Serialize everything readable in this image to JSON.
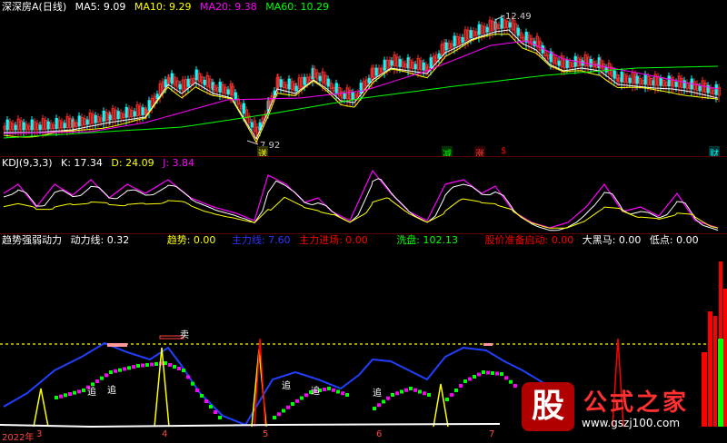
{
  "colors": {
    "bg": "#000000",
    "white": "#ffffff",
    "yellow": "#ffff00",
    "magenta": "#ff00ff",
    "green": "#00ff00",
    "cyan": "#00ffff",
    "blue": "#0000ff",
    "red": "#ff0000",
    "orange": "#ff8800"
  },
  "top": {
    "title": "深深房A(日线)",
    "ma": [
      {
        "label": "MA5: 9.09",
        "color": "#ffffff"
      },
      {
        "label": "MA10: 9.29",
        "color": "#ffff00"
      },
      {
        "label": "MA20: 9.38",
        "color": "#ff00ff"
      },
      {
        "label": "MA60: 10.29",
        "color": "#00ff00"
      }
    ],
    "high_label": "12.49",
    "low_label": "7.92",
    "events": [
      {
        "label": "送",
        "color": "#ffff00"
      },
      {
        "label": "减",
        "color": "#00ff00"
      },
      {
        "label": "涨",
        "color": "#ff0000"
      },
      {
        "label": "$",
        "color": "#ff0000"
      },
      {
        "label": "财",
        "color": "#00ffff"
      }
    ]
  },
  "kdj": {
    "title": "KDJ(9,3,3)",
    "k": "K: 17.34",
    "d": "D: 24.09",
    "j": "J: 3.84"
  },
  "bottom": {
    "title": "趋势强弱动力",
    "items": [
      {
        "label": "动力线: 0.32",
        "color": "#ffffff"
      },
      {
        "label": "趋势: 0.00",
        "color": "#ffff00"
      },
      {
        "label": "主力线: 7.60",
        "color": "#3333ff"
      },
      {
        "label": "主力进场: 0.00",
        "color": "#ff0000"
      },
      {
        "label": "洗盘: 102.13",
        "color": "#00ff00"
      },
      {
        "label": "股价准备启动: 0.00",
        "color": "#ff0000"
      },
      {
        "label": "大黑马: 0.00",
        "color": "#ffffff"
      },
      {
        "label": "低点: 0.00",
        "color": "#ffffff"
      }
    ],
    "sell_label": "卖",
    "chase_label": "追",
    "x_axis": [
      "2022年",
      "3",
      "4",
      "5",
      "6",
      "7"
    ]
  },
  "watermark": {
    "char": "股",
    "text": "公式之家",
    "url": "www.gszj100.com"
  }
}
